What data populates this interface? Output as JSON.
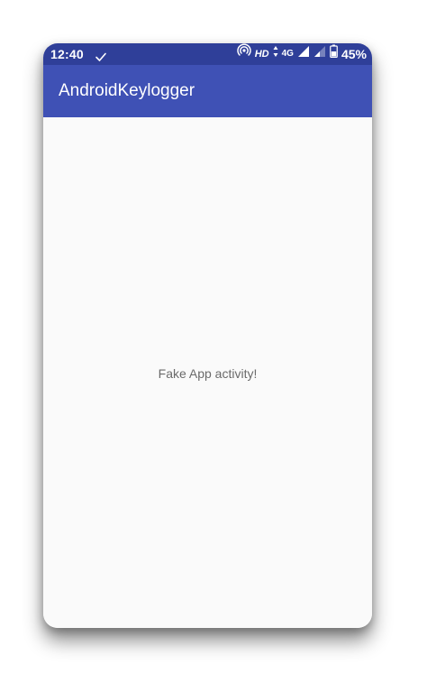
{
  "status_bar": {
    "time": "12:40",
    "hd": "HD",
    "network": "4G",
    "battery": "45%",
    "icons": [
      "check-icon",
      "hotspot-icon",
      "data-arrows-icon",
      "signal-icon",
      "signal-weak-icon",
      "battery-icon"
    ]
  },
  "app_bar": {
    "title": "AndroidKeylogger"
  },
  "content": {
    "message": "Fake App activity!"
  },
  "colors": {
    "status_bar": "#2f3f99",
    "app_bar": "#3f51b5",
    "background": "#fafafa",
    "text": "#6a6a6a"
  }
}
